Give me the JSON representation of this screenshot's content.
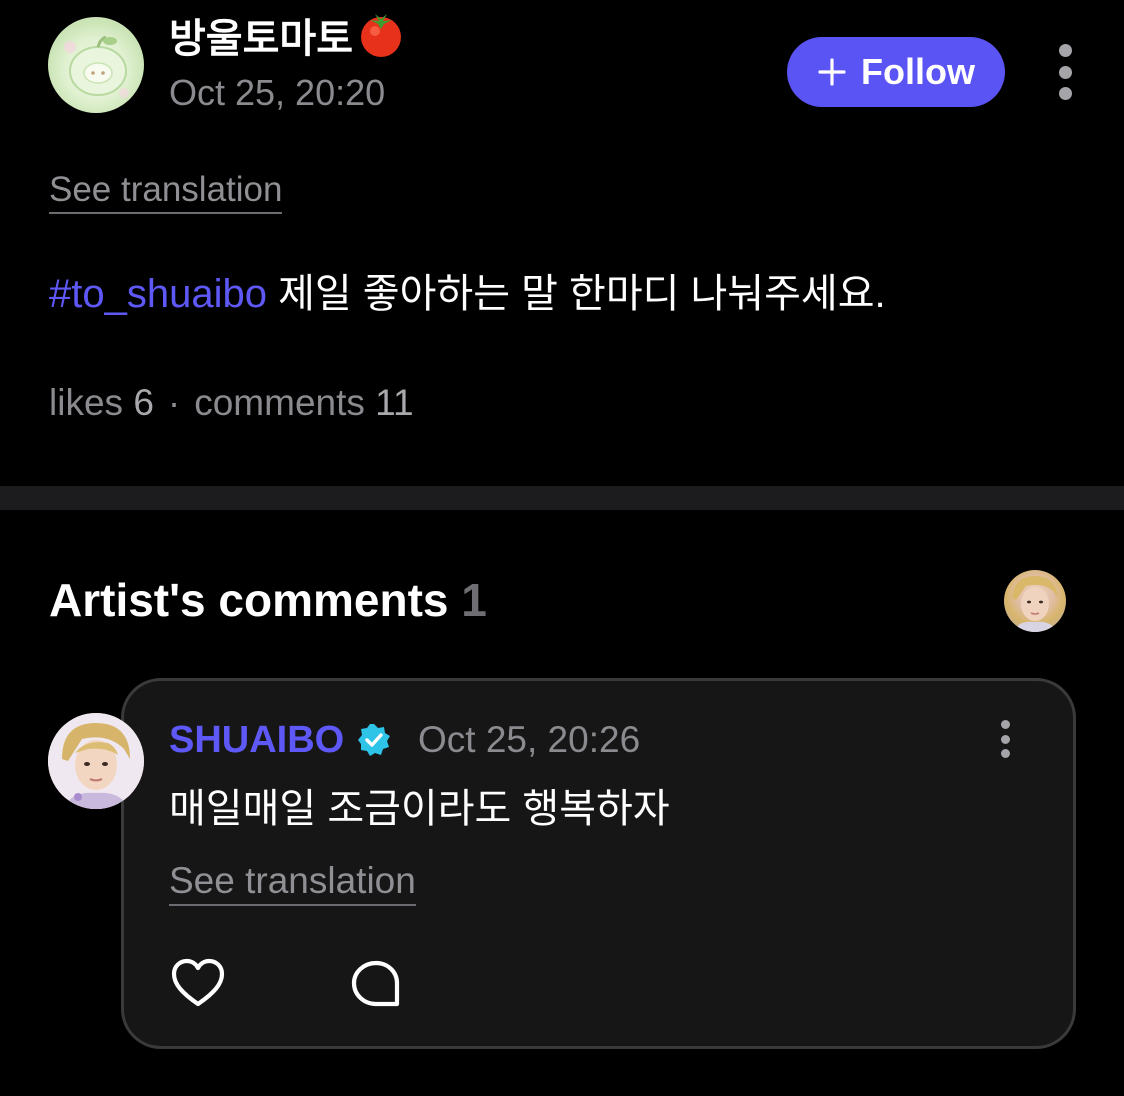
{
  "post": {
    "author": "방울토마토",
    "author_emoji_icon": "tomato-icon",
    "date": "Oct 25, 20:20",
    "follow_label": "Follow",
    "see_translation": "See translation",
    "hashtag": "#to_shuaibo",
    "body": " 제일 좋아하는 말 한마디 나눠주세요.",
    "likes_label": "likes",
    "likes_count": "6",
    "separator": "·",
    "comments_label": "comments",
    "comments_count": "11"
  },
  "artist_comments": {
    "title": "Artist's comments",
    "count": "1",
    "comment": {
      "author": "SHUAIBO",
      "verified_icon": "verified-badge-icon",
      "date": "Oct 25, 20:26",
      "body": "매일매일 조금이라도 행복하자",
      "see_translation": "See translation"
    }
  },
  "colors": {
    "background": "#000000",
    "accent": "#5b54f5",
    "verified": "#2ec4e8",
    "muted_text": "#8a8a8f",
    "divider": "#1c1c1e",
    "card_background": "#161617",
    "card_border": "#3a3a3d"
  }
}
